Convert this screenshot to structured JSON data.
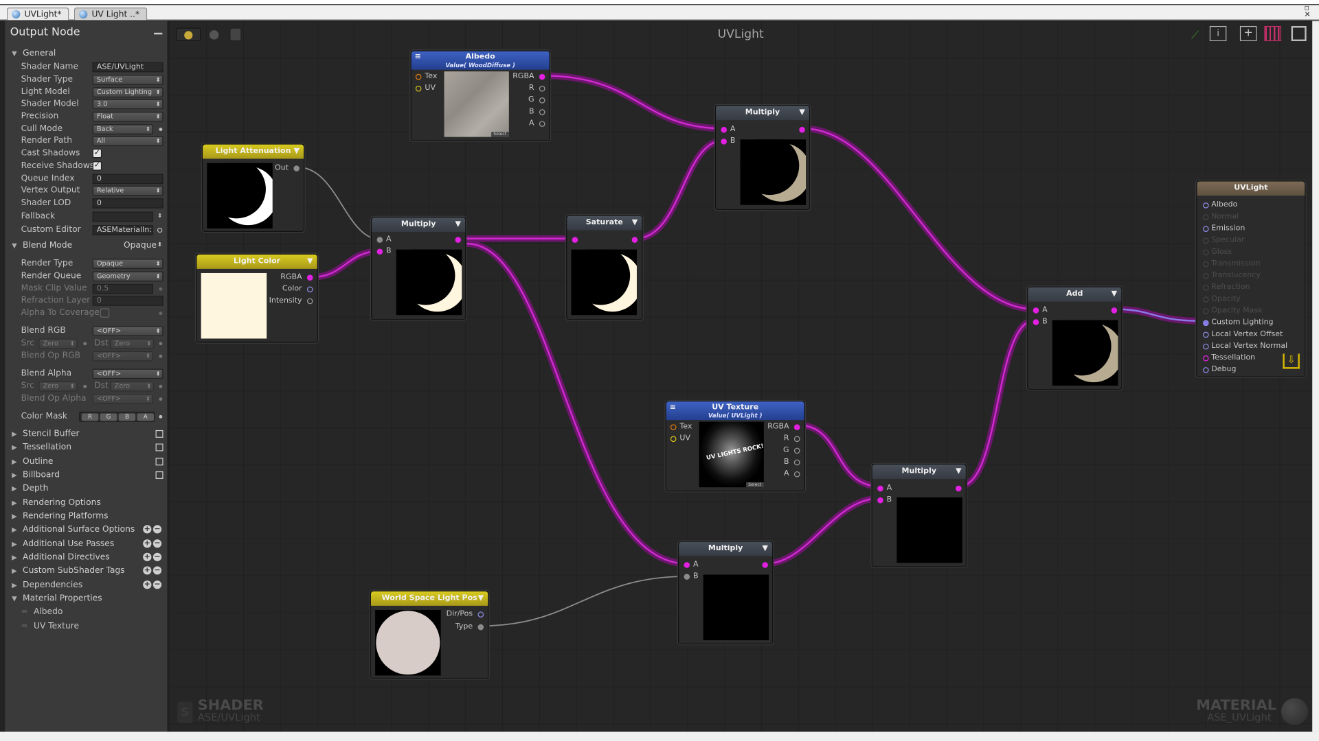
{
  "tabs": [
    {
      "label": "UVLight*"
    },
    {
      "label": "UV Light ..*"
    }
  ],
  "panel": {
    "title": "Output Node",
    "general": {
      "header": "General",
      "rows": [
        {
          "label": "Shader Name",
          "value": "ASE/UVLight"
        },
        {
          "label": "Shader Type",
          "value": "Surface"
        },
        {
          "label": "Light Model",
          "value": "Custom Lighting"
        },
        {
          "label": "Shader Model",
          "value": "3.0"
        },
        {
          "label": "Precision",
          "value": "Float"
        },
        {
          "label": "Cull Mode",
          "value": "Back"
        },
        {
          "label": "Render Path",
          "value": "All"
        },
        {
          "label": "Cast Shadows",
          "value": "✓"
        },
        {
          "label": "Receive Shadows",
          "value": "✓"
        },
        {
          "label": "Queue Index",
          "value": "0"
        },
        {
          "label": "Vertex Output",
          "value": "Relative"
        },
        {
          "label": "Shader LOD",
          "value": "0"
        },
        {
          "label": "Fallback",
          "value": ""
        },
        {
          "label": "Custom Editor",
          "value": "ASEMaterialIn:"
        }
      ]
    },
    "blend": {
      "header": "Blend Mode",
      "value": "Opaque",
      "rows": [
        {
          "label": "Render Type",
          "value": "Opaque"
        },
        {
          "label": "Render Queue",
          "value": "Geometry"
        },
        {
          "label": "Mask Clip Value",
          "value": "0.5"
        },
        {
          "label": "Refraction Layer",
          "value": "0"
        },
        {
          "label": "Alpha To Coverage",
          "value": ""
        },
        {
          "label": "Blend RGB",
          "value": "<OFF>"
        },
        {
          "label": "Src",
          "value": "Zero",
          "label2": "Dst",
          "value2": "Zero"
        },
        {
          "label": "Blend Op RGB",
          "value": "<OFF>"
        },
        {
          "label": "Blend Alpha",
          "value": "<OFF>"
        },
        {
          "label": "Src",
          "value": "Zero",
          "label2": "Dst",
          "value2": "Zero"
        },
        {
          "label": "Blend Op Alpha",
          "value": "<OFF>"
        },
        {
          "label": "Color Mask",
          "channels": [
            "R",
            "G",
            "B",
            "A"
          ]
        }
      ]
    },
    "sections": [
      {
        "label": "Stencil Buffer"
      },
      {
        "label": "Tessellation"
      },
      {
        "label": "Outline"
      },
      {
        "label": "Billboard"
      },
      {
        "label": "Depth"
      },
      {
        "label": "Rendering Options"
      },
      {
        "label": "Rendering Platforms"
      },
      {
        "label": "Additional Surface Options"
      },
      {
        "label": "Additional Use Passes"
      },
      {
        "label": "Additional Directives"
      },
      {
        "label": "Custom SubShader Tags"
      },
      {
        "label": "Dependencies"
      },
      {
        "label": "Material Properties"
      }
    ],
    "material_properties": [
      "Albedo",
      "UV Texture"
    ]
  },
  "canvas": {
    "title": "UVLight",
    "watermark_left": {
      "main": "SHADER",
      "sub": "ASE/UVLight"
    },
    "watermark_right": {
      "main": "MATERIAL",
      "sub": "ASE_UVLight"
    }
  },
  "nodes": {
    "albedo": {
      "title": "Albedo",
      "subtitle": "Value( WoodDiffuse )",
      "inputs": [
        "Tex",
        "UV"
      ],
      "outputs": [
        "RGBA",
        "R",
        "G",
        "B",
        "A"
      ],
      "select": "Select"
    },
    "light_attenuation": {
      "title": "Light Attenuation",
      "outputs": [
        "Out"
      ]
    },
    "light_color": {
      "title": "Light Color",
      "outputs": [
        "RGBA",
        "Color",
        "Intensity"
      ]
    },
    "multiply1": {
      "title": "Multiply",
      "inputs": [
        "A",
        "B"
      ]
    },
    "saturate": {
      "title": "Saturate"
    },
    "multiply2": {
      "title": "Multiply",
      "inputs": [
        "A",
        "B"
      ]
    },
    "uv_texture": {
      "title": "UV Texture",
      "subtitle": "Value( UVLight )",
      "inputs": [
        "Tex",
        "UV"
      ],
      "outputs": [
        "RGBA",
        "R",
        "G",
        "B",
        "A"
      ],
      "select": "Select",
      "art_text": "UV LIGHTS ROCK!"
    },
    "multiply3": {
      "title": "Multiply",
      "inputs": [
        "A",
        "B"
      ]
    },
    "multiply4": {
      "title": "Multiply",
      "inputs": [
        "A",
        "B"
      ]
    },
    "world_space_light_pos": {
      "title": "World Space Light Pos",
      "outputs": [
        "Dir/Pos",
        "Type"
      ]
    },
    "add": {
      "title": "Add",
      "inputs": [
        "A",
        "B"
      ]
    },
    "output": {
      "title": "UVLight",
      "ports": [
        {
          "label": "Albedo",
          "active": true
        },
        {
          "label": "Normal",
          "active": false
        },
        {
          "label": "Emission",
          "active": true
        },
        {
          "label": "Specular",
          "active": false
        },
        {
          "label": "Gloss",
          "active": false
        },
        {
          "label": "Transmission",
          "active": false
        },
        {
          "label": "Translucency",
          "active": false
        },
        {
          "label": "Refraction",
          "active": false
        },
        {
          "label": "Opacity",
          "active": false
        },
        {
          "label": "Opacity Mask",
          "active": false
        },
        {
          "label": "Custom Lighting",
          "active": true
        },
        {
          "label": "Local Vertex Offset",
          "active": true
        },
        {
          "label": "Local Vertex Normal",
          "active": true
        },
        {
          "label": "Tessellation",
          "active": true
        },
        {
          "label": "Debug",
          "active": true
        }
      ]
    }
  },
  "colors": {
    "wire": "#c21fc2",
    "accent_yellow": "#d9cb20",
    "accent_blue": "#3e62c4"
  }
}
